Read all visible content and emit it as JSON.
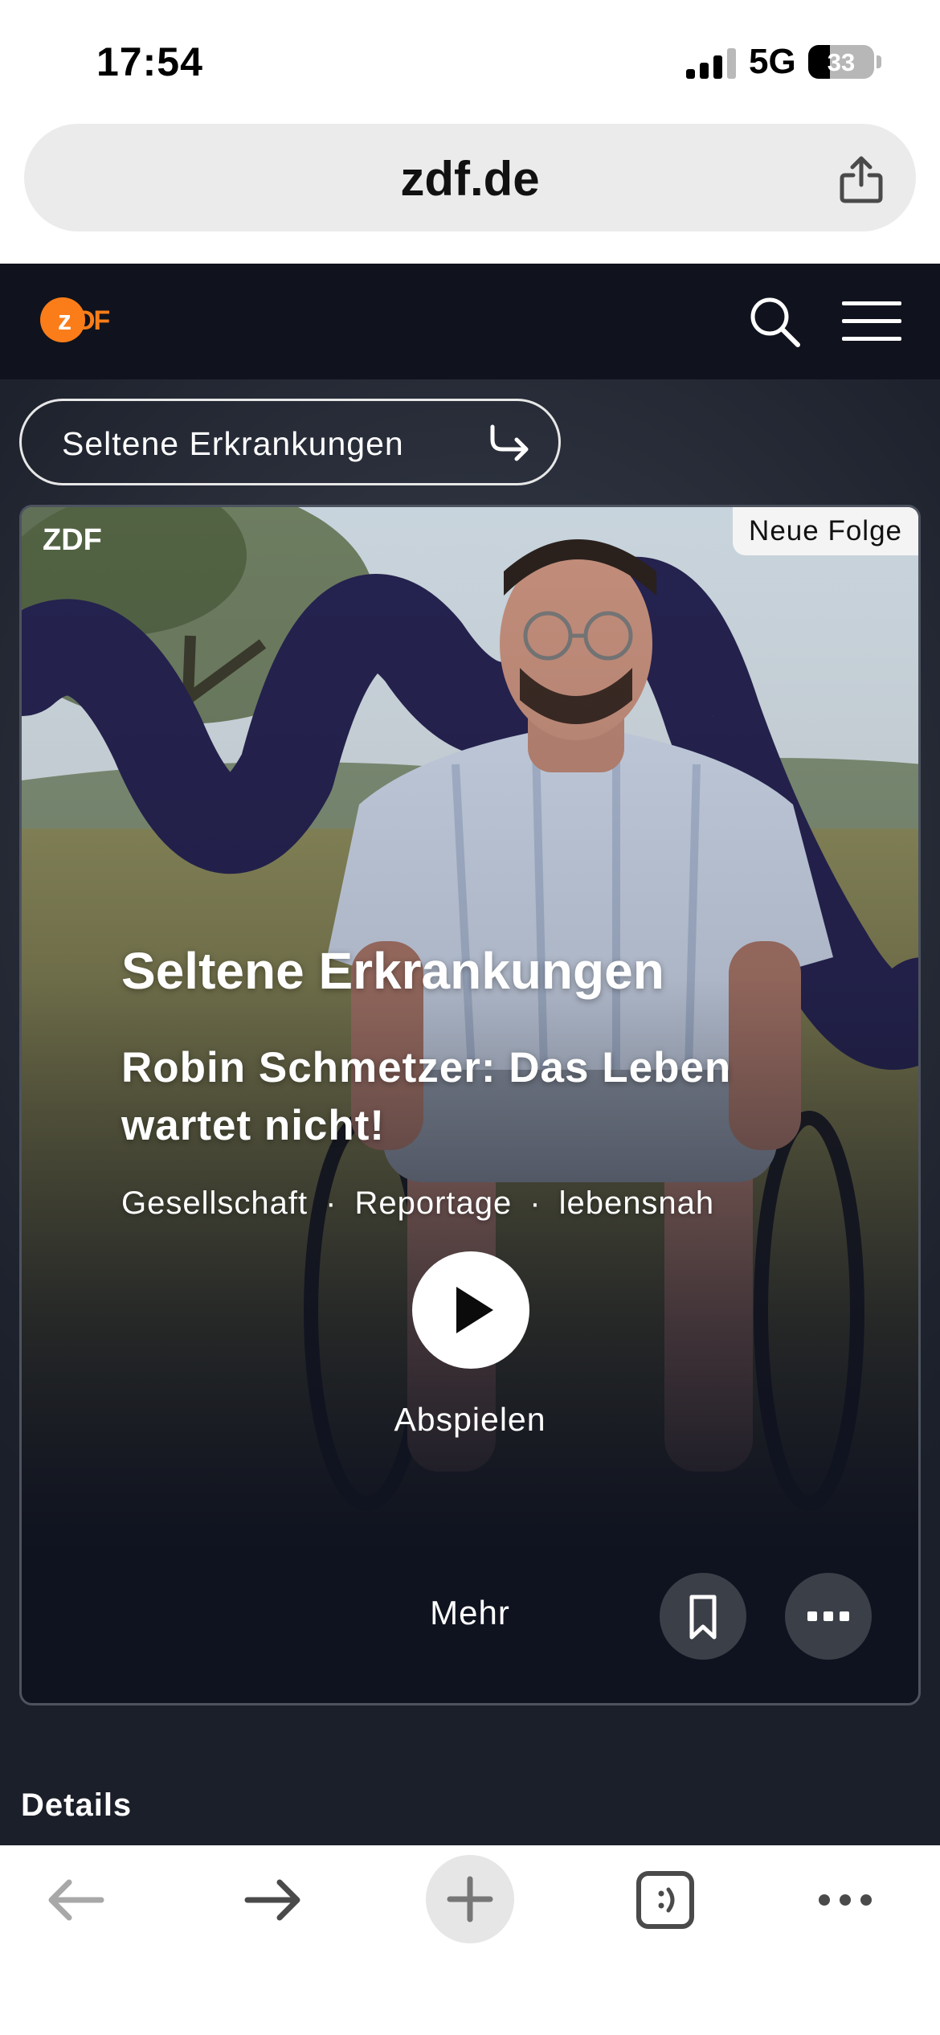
{
  "status_bar": {
    "time": "17:54",
    "network": "5G",
    "battery": "33"
  },
  "browser": {
    "url": "zdf.de"
  },
  "site": {
    "logo": "ZDF",
    "brand_color": "#fa7d19",
    "header_bg": "#10131d"
  },
  "topic_pill": {
    "label": "Seltene Erkrankungen"
  },
  "hero": {
    "channel": "ZDF",
    "badge": "Neue Folge",
    "show_title": "Seltene Erkrankungen",
    "episode_title": "Robin Schmetzer: Das Leben wartet nicht!",
    "tags": [
      "Gesellschaft",
      "Reportage",
      "lebensnah"
    ],
    "tag_separator": "·",
    "play_label": "Abspielen",
    "more_label": "Mehr"
  },
  "details": {
    "heading": "Details"
  },
  "icons": {
    "share": "share-icon",
    "search": "search-icon",
    "menu": "hamburger-menu-icon",
    "play": "play-icon",
    "bookmark": "bookmark-icon",
    "options": "more-options-icon",
    "back": "back-arrow-icon",
    "forward": "forward-arrow-icon",
    "new_tab": "plus-icon",
    "tabs": "tabs-icon",
    "more": "ellipsis-icon"
  }
}
